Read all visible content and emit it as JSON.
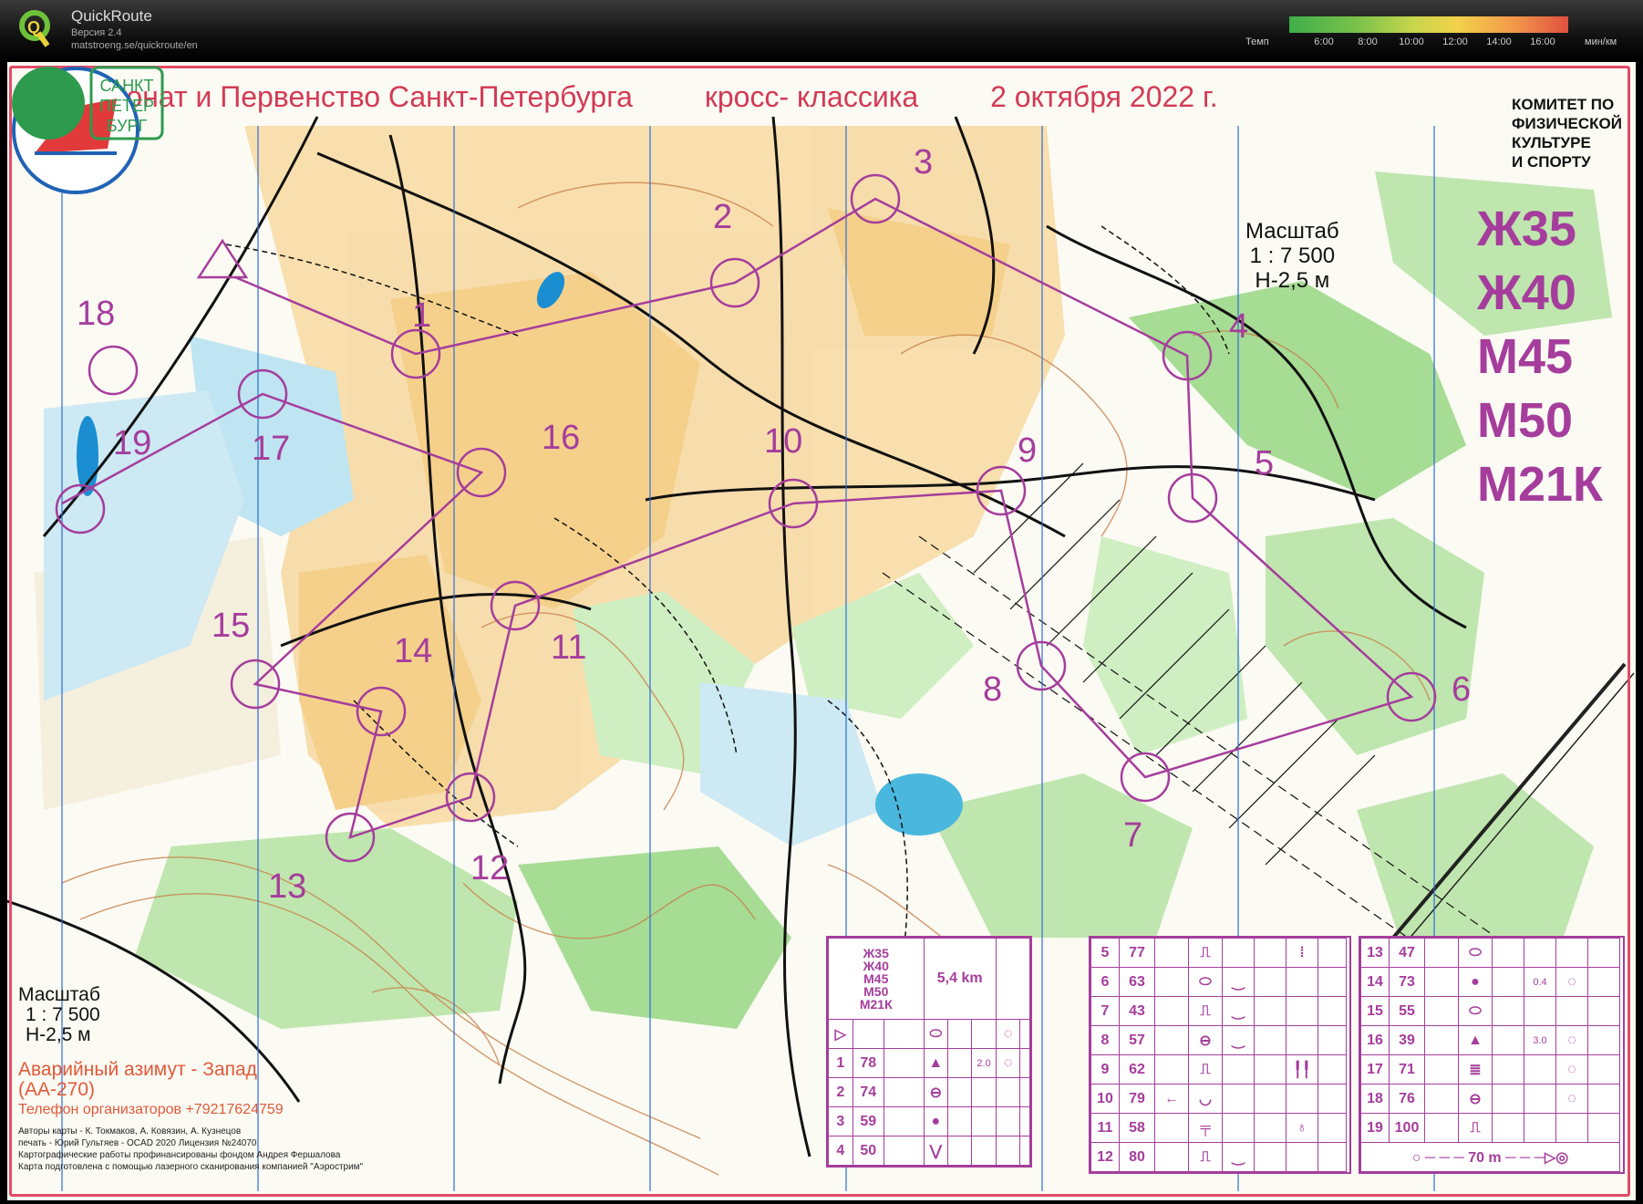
{
  "app": {
    "name": "QuickRoute",
    "version": "Версия 2.4",
    "url": "matstroeng.se/quickroute/en",
    "pace_label": "Темп",
    "pace_unit": "мин/км",
    "pace_ticks": [
      "6:00",
      "8:00",
      "10:00",
      "12:00",
      "14:00",
      "16:00"
    ]
  },
  "map": {
    "title_parts": [
      "Чемпионат и Первенство Санкт-Петербурга",
      "кросс- классика",
      "2 октября 2022 г."
    ],
    "scale_top": [
      "Масштаб",
      "1 : 7 500",
      "Н-2,5 м"
    ],
    "classes": [
      "Ж35",
      "Ж40",
      "М45",
      "М50",
      "М21К"
    ],
    "committee": [
      "КОМИТЕТ ПО",
      "ФИЗИЧЕСКОЙ",
      "КУЛЬТУРЕ",
      "И СПОРТУ"
    ],
    "spb_logo_text": [
      "САНКТ",
      "ПЕТЕР",
      "БУРГ"
    ],
    "scale_bottom": [
      "Масштаб",
      "1 : 7 500",
      "Н-2,5 м"
    ],
    "emergency": [
      "Аварийный азимут - Запад",
      "(АА-270)"
    ],
    "phone": "Телефон организаторов +79217624759",
    "credits": [
      "Авторы карты - К. Токмаков, А. Ковязин, А. Кузнецов",
      "печать - Юрий Гультяев - OCAD 2020 Лицензия №24070",
      "Картографические работы профинансированы фондом Андрея Фершалова",
      "Карта подготовлена с помощью лазерного сканирования компанией \"Аэрострим\""
    ],
    "controls": [
      {
        "n": "1"
      },
      {
        "n": "2"
      },
      {
        "n": "3"
      },
      {
        "n": "4"
      },
      {
        "n": "5"
      },
      {
        "n": "6"
      },
      {
        "n": "7"
      },
      {
        "n": "8"
      },
      {
        "n": "9"
      },
      {
        "n": "10"
      },
      {
        "n": "11"
      },
      {
        "n": "12"
      },
      {
        "n": "13"
      },
      {
        "n": "14"
      },
      {
        "n": "15"
      },
      {
        "n": "16"
      },
      {
        "n": "17"
      },
      {
        "n": "18"
      },
      {
        "n": "19"
      }
    ]
  },
  "description": {
    "classes": [
      "Ж35",
      "Ж40",
      "М45",
      "М50",
      "М21К"
    ],
    "length": "5,4 km",
    "col1": [
      {
        "n": "1",
        "code": "78",
        "dist": "2.0"
      },
      {
        "n": "2",
        "code": "74"
      },
      {
        "n": "3",
        "code": "59"
      },
      {
        "n": "4",
        "code": "50"
      }
    ],
    "col2": [
      {
        "n": "5",
        "code": "77"
      },
      {
        "n": "6",
        "code": "63"
      },
      {
        "n": "7",
        "code": "43"
      },
      {
        "n": "8",
        "code": "57"
      },
      {
        "n": "9",
        "code": "62"
      },
      {
        "n": "10",
        "code": "79"
      },
      {
        "n": "11",
        "code": "58"
      },
      {
        "n": "12",
        "code": "80"
      }
    ],
    "col3": [
      {
        "n": "13",
        "code": "47"
      },
      {
        "n": "14",
        "code": "73",
        "dist": "0.4"
      },
      {
        "n": "15",
        "code": "55"
      },
      {
        "n": "16",
        "code": "39",
        "dist": "3.0"
      },
      {
        "n": "17",
        "code": "71"
      },
      {
        "n": "18",
        "code": "76"
      },
      {
        "n": "19",
        "code": "100"
      }
    ],
    "finish_dist": "70 m"
  }
}
